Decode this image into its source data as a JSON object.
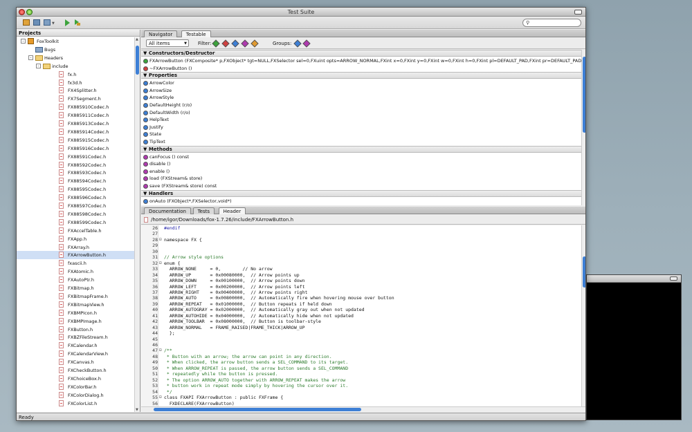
{
  "window": {
    "title": "Test Suite"
  },
  "search": {
    "placeholder": ""
  },
  "projects": {
    "header": "Projects",
    "tree": [
      {
        "label": "FoxToolkit",
        "indent": 0,
        "kind": "project",
        "exp": "-"
      },
      {
        "label": "Bugs",
        "indent": 1,
        "kind": "bugs",
        "exp": ""
      },
      {
        "label": "Headers",
        "indent": 1,
        "kind": "folder",
        "exp": "-"
      },
      {
        "label": "include",
        "indent": 2,
        "kind": "folder",
        "exp": "-"
      },
      {
        "label": "fx.h",
        "indent": 3,
        "kind": "file"
      },
      {
        "label": "fx3d.h",
        "indent": 3,
        "kind": "file"
      },
      {
        "label": "FX4Splitter.h",
        "indent": 3,
        "kind": "file"
      },
      {
        "label": "FX7Segment.h",
        "indent": 3,
        "kind": "file"
      },
      {
        "label": "FX885910Codec.h",
        "indent": 3,
        "kind": "file"
      },
      {
        "label": "FX885911Codec.h",
        "indent": 3,
        "kind": "file"
      },
      {
        "label": "FX885913Codec.h",
        "indent": 3,
        "kind": "file"
      },
      {
        "label": "FX885914Codec.h",
        "indent": 3,
        "kind": "file"
      },
      {
        "label": "FX885915Codec.h",
        "indent": 3,
        "kind": "file"
      },
      {
        "label": "FX885916Codec.h",
        "indent": 3,
        "kind": "file"
      },
      {
        "label": "FX88591Codec.h",
        "indent": 3,
        "kind": "file"
      },
      {
        "label": "FX88592Codec.h",
        "indent": 3,
        "kind": "file"
      },
      {
        "label": "FX88593Codec.h",
        "indent": 3,
        "kind": "file"
      },
      {
        "label": "FX88594Codec.h",
        "indent": 3,
        "kind": "file"
      },
      {
        "label": "FX88595Codec.h",
        "indent": 3,
        "kind": "file"
      },
      {
        "label": "FX88596Codec.h",
        "indent": 3,
        "kind": "file"
      },
      {
        "label": "FX88597Codec.h",
        "indent": 3,
        "kind": "file"
      },
      {
        "label": "FX88598Codec.h",
        "indent": 3,
        "kind": "file"
      },
      {
        "label": "FX88599Codec.h",
        "indent": 3,
        "kind": "file"
      },
      {
        "label": "FXAccelTable.h",
        "indent": 3,
        "kind": "file"
      },
      {
        "label": "FXApp.h",
        "indent": 3,
        "kind": "file"
      },
      {
        "label": "FXArray.h",
        "indent": 3,
        "kind": "file"
      },
      {
        "label": "FXArrowButton.h",
        "indent": 3,
        "kind": "file",
        "selected": true
      },
      {
        "label": "fxascii.h",
        "indent": 3,
        "kind": "file"
      },
      {
        "label": "FXAtomic.h",
        "indent": 3,
        "kind": "file"
      },
      {
        "label": "FXAutoPtr.h",
        "indent": 3,
        "kind": "file"
      },
      {
        "label": "FXBitmap.h",
        "indent": 3,
        "kind": "file"
      },
      {
        "label": "FXBitmapFrame.h",
        "indent": 3,
        "kind": "file"
      },
      {
        "label": "FXBitmapView.h",
        "indent": 3,
        "kind": "file"
      },
      {
        "label": "FXBMPIcon.h",
        "indent": 3,
        "kind": "file"
      },
      {
        "label": "FXBMPImage.h",
        "indent": 3,
        "kind": "file"
      },
      {
        "label": "FXButton.h",
        "indent": 3,
        "kind": "file"
      },
      {
        "label": "FXBZFileStream.h",
        "indent": 3,
        "kind": "file"
      },
      {
        "label": "FXCalendar.h",
        "indent": 3,
        "kind": "file"
      },
      {
        "label": "FXCalendarView.h",
        "indent": 3,
        "kind": "file"
      },
      {
        "label": "FXCanvas.h",
        "indent": 3,
        "kind": "file"
      },
      {
        "label": "FXCheckButton.h",
        "indent": 3,
        "kind": "file"
      },
      {
        "label": "FXChoiceBox.h",
        "indent": 3,
        "kind": "file"
      },
      {
        "label": "FXColorBar.h",
        "indent": 3,
        "kind": "file"
      },
      {
        "label": "FXColorDialog.h",
        "indent": 3,
        "kind": "file"
      },
      {
        "label": "FXColorList.h",
        "indent": 3,
        "kind": "file"
      }
    ]
  },
  "top_tabs": [
    "Navigator",
    "Testable"
  ],
  "top_tabs_active": 1,
  "filter": {
    "select_value": "All items",
    "filter_label": "Filter:",
    "groups_label": "Groups:"
  },
  "sections": {
    "constructors": "Constructors/Destructor",
    "properties": "Properties",
    "methods": "Methods",
    "handlers": "Handlers"
  },
  "constructors": [
    {
      "text": "FXArrowButton (FXComposite* p,FXObject* tgt=NULL,FXSelector sel=0,FXuint opts=ARROW_NORMAL,FXint x=0,FXint y=0,FXint w=0,FXint h=0,FXint pl=DEFAULT_PAD,FXint pr=DEFAULT_PAD",
      "color": "#3ca33c"
    },
    {
      "text": "~FXArrowButton ()",
      "color": "#d04040"
    }
  ],
  "properties": [
    "ArrowColor",
    "ArrowSize",
    "ArrowStyle",
    "DefaultHeight (r/o)",
    "DefaultWidth (r/o)",
    "HelpText",
    "Justify",
    "State",
    "TipText"
  ],
  "methods": [
    "canFocus () const",
    "disable ()",
    "enable ()",
    "load (FXStream& store)",
    "save (FXStream& store) const"
  ],
  "handlers": [
    "onAuto (FXObject*,FXSelector,void*)"
  ],
  "bottom_tabs": [
    "Documentation",
    "Tests",
    "Header"
  ],
  "bottom_tabs_active": 2,
  "path": "/home/igor/Downloads/fox-1.7.26/include/FXArrowButton.h",
  "code_lines": [
    {
      "n": "26",
      "fm": "",
      "t": "#endif",
      "c": "kw"
    },
    {
      "n": "27",
      "fm": "",
      "t": "",
      "c": ""
    },
    {
      "n": "28",
      "fm": "⊟",
      "t": "namespace FX {",
      "c": ""
    },
    {
      "n": "29",
      "fm": "",
      "t": "",
      "c": ""
    },
    {
      "n": "30",
      "fm": "",
      "t": "",
      "c": ""
    },
    {
      "n": "31",
      "fm": "",
      "t": "// Arrow style options",
      "c": "cm"
    },
    {
      "n": "32",
      "fm": "⊟",
      "t": "enum {",
      "c": ""
    },
    {
      "n": "33",
      "fm": "",
      "t": "  ARROW_NONE     = 0,        // No arrow",
      "c": ""
    },
    {
      "n": "34",
      "fm": "",
      "t": "  ARROW_UP       = 0x00080000,  // Arrow points up",
      "c": ""
    },
    {
      "n": "35",
      "fm": "",
      "t": "  ARROW_DOWN     = 0x00100000,  // Arrow points down",
      "c": ""
    },
    {
      "n": "36",
      "fm": "",
      "t": "  ARROW_LEFT     = 0x00200000,  // Arrow points left",
      "c": ""
    },
    {
      "n": "37",
      "fm": "",
      "t": "  ARROW_RIGHT    = 0x00400000,  // Arrow points right",
      "c": ""
    },
    {
      "n": "38",
      "fm": "",
      "t": "  ARROW_AUTO     = 0x00800000,  // Automatically fire when hovering mouse over button",
      "c": ""
    },
    {
      "n": "39",
      "fm": "",
      "t": "  ARROW_REPEAT   = 0x01000000,  // Button repeats if held down",
      "c": ""
    },
    {
      "n": "40",
      "fm": "",
      "t": "  ARROW_AUTOGRAY = 0x02000000,  // Automatically gray out when not updated",
      "c": ""
    },
    {
      "n": "41",
      "fm": "",
      "t": "  ARROW_AUTOHIDE = 0x04000000,  // Automatically hide when not updated",
      "c": ""
    },
    {
      "n": "42",
      "fm": "",
      "t": "  ARROW_TOOLBAR  = 0x08000000,  // Button is toolbar-style",
      "c": ""
    },
    {
      "n": "43",
      "fm": "",
      "t": "  ARROW_NORMAL   = FRAME_RAISED|FRAME_THICK|ARROW_UP",
      "c": ""
    },
    {
      "n": "44",
      "fm": "",
      "t": "  };",
      "c": ""
    },
    {
      "n": "45",
      "fm": "",
      "t": "",
      "c": ""
    },
    {
      "n": "46",
      "fm": "",
      "t": "",
      "c": ""
    },
    {
      "n": "47",
      "fm": "⊟",
      "t": "/**",
      "c": "cm"
    },
    {
      "n": "48",
      "fm": "",
      "t": " * Button with an arrow; the arrow can point in any direction.",
      "c": "cm"
    },
    {
      "n": "49",
      "fm": "",
      "t": " * When clicked, the arrow button sends a SEL_COMMAND to its target.",
      "c": "cm"
    },
    {
      "n": "50",
      "fm": "",
      "t": " * When ARROW_REPEAT is passed, the arrow button sends a SEL_COMMAND",
      "c": "cm"
    },
    {
      "n": "51",
      "fm": "",
      "t": " * repeatedly while the button is pressed.",
      "c": "cm"
    },
    {
      "n": "52",
      "fm": "",
      "t": " * The option ARROW_AUTO together with ARROW_REPEAT makes the arrow",
      "c": "cm"
    },
    {
      "n": "53",
      "fm": "",
      "t": " * button work in repeat mode simply by hovering the cursor over it.",
      "c": "cm"
    },
    {
      "n": "54",
      "fm": "",
      "t": " */",
      "c": "cm"
    },
    {
      "n": "55",
      "fm": "⊟",
      "t": "class FXAPI FXArrowButton : public FXFrame {",
      "c": ""
    },
    {
      "n": "56",
      "fm": "",
      "t": "  FXDECLARE(FXArrowButton)",
      "c": ""
    }
  ],
  "status": "Ready",
  "colors": {
    "accent": "#3d7fd5",
    "selection": "#cfdff5",
    "property": "#3d7fd5",
    "method": "#b03ab0",
    "handler": "#3d7fd5"
  }
}
